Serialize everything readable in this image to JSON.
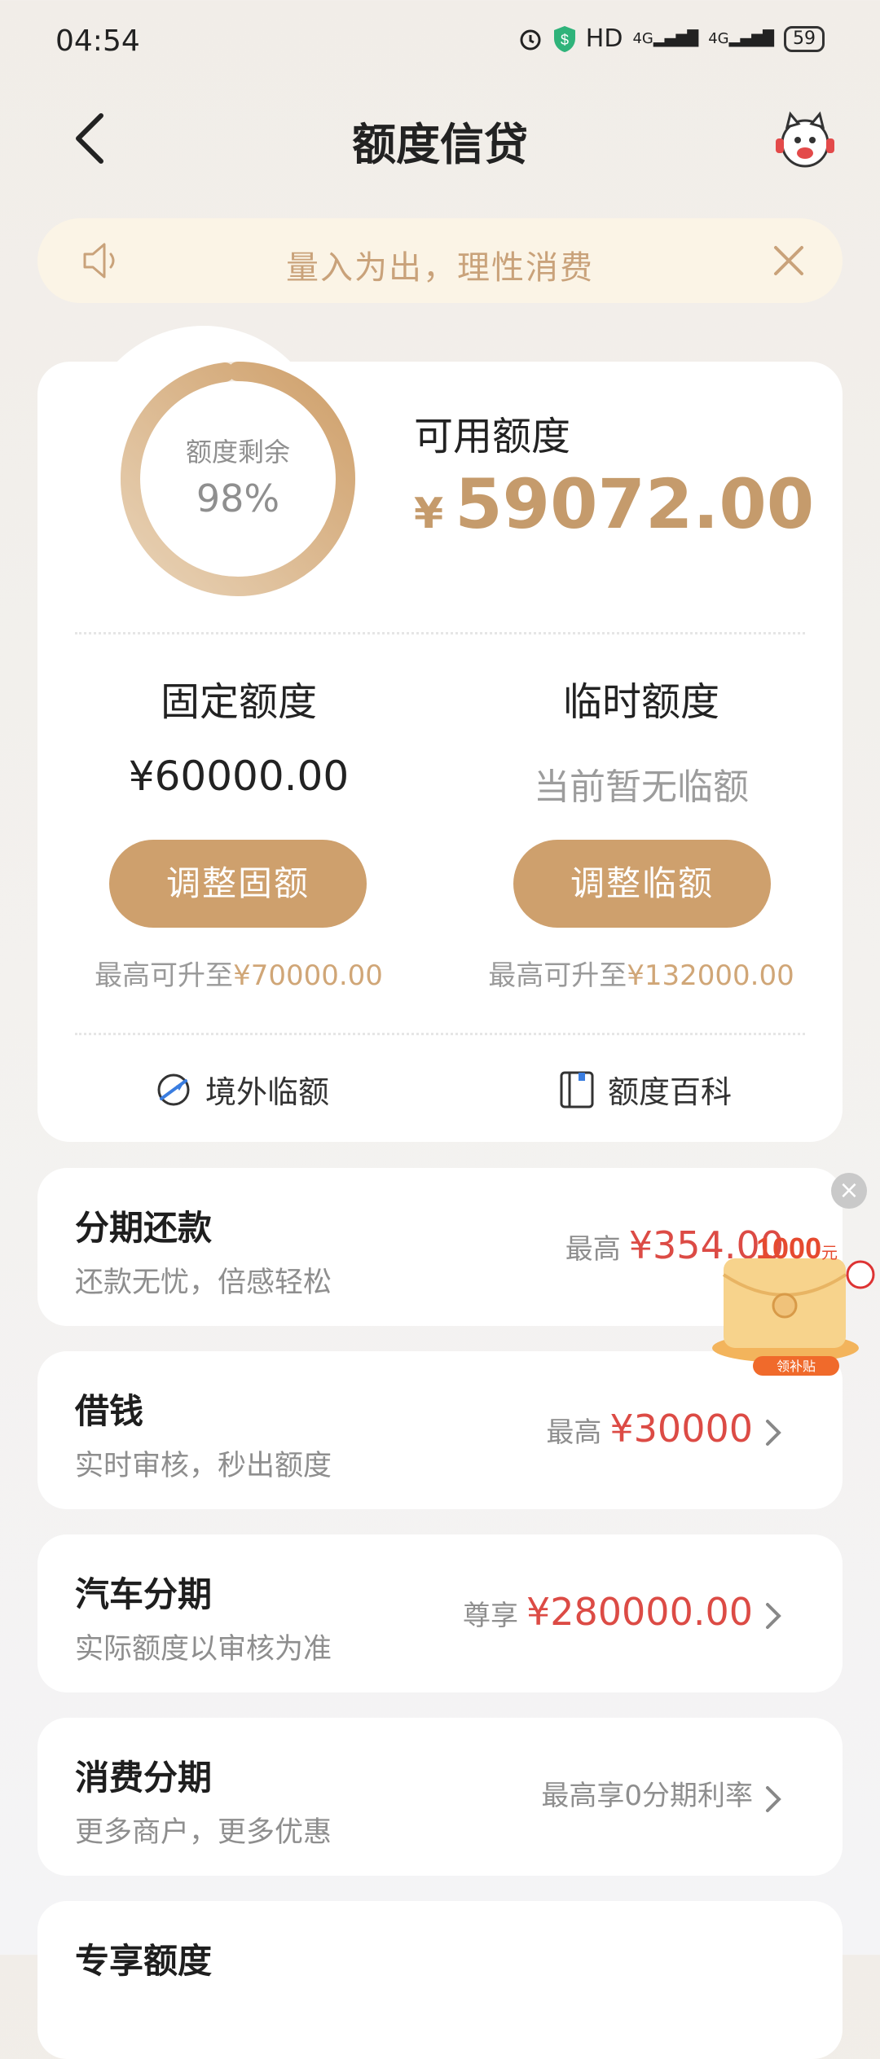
{
  "status": {
    "time": "04:54",
    "network": "HD",
    "signal1": "4G",
    "signal2": "4G",
    "battery": "59"
  },
  "header": {
    "title": "额度信贷"
  },
  "notice": {
    "text": "量入为出，理性消费"
  },
  "quota": {
    "ring_label": "额度剩余",
    "ring_value": "98%",
    "ring_percent": 98,
    "available_label": "可用额度",
    "available_currency": "¥",
    "available_amount": "59072.00",
    "fixed": {
      "title": "固定额度",
      "value": "¥60000.00",
      "button": "调整固额",
      "max_prefix": "最高可升至",
      "max_value": "¥70000.00"
    },
    "temp": {
      "title": "临时额度",
      "value": "当前暂无临额",
      "button": "调整临额",
      "max_prefix": "最高可升至",
      "max_value": "¥132000.00"
    },
    "links": {
      "overseas": "境外临额",
      "wiki": "额度百科"
    }
  },
  "list": [
    {
      "title": "分期还款",
      "sub": "还款无忧，倍感轻松",
      "pre": "最高",
      "amount": "¥354.00"
    },
    {
      "title": "借钱",
      "sub": "实时审核，秒出额度",
      "pre": "最高",
      "amount": "¥30000"
    },
    {
      "title": "汽车分期",
      "sub": "实际额度以审核为准",
      "pre": "尊享",
      "amount": "¥280000.00"
    },
    {
      "title": "消费分期",
      "sub": "更多商户，更多优惠",
      "pre": "最高享0分期利率",
      "amount": ""
    },
    {
      "title": "专享额度"
    }
  ],
  "promo": {
    "amount": "1000",
    "unit": "元",
    "tag": "领补贴"
  },
  "colors": {
    "accent": "#cea06d",
    "amount_red": "#dc4b45",
    "notice_bg": "#fbf4e6"
  }
}
